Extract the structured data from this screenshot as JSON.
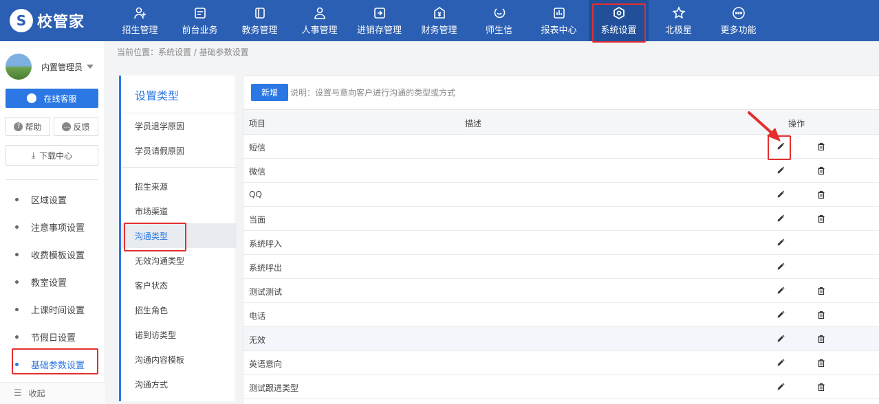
{
  "app": {
    "logo_text": "校管家"
  },
  "nav": [
    {
      "label": "招生管理",
      "icon": "user-plus-icon"
    },
    {
      "label": "前台业务",
      "icon": "card-icon"
    },
    {
      "label": "教务管理",
      "icon": "book-icon"
    },
    {
      "label": "人事管理",
      "icon": "person-icon"
    },
    {
      "label": "进销存管理",
      "icon": "inventory-icon"
    },
    {
      "label": "财务管理",
      "icon": "money-icon"
    },
    {
      "label": "师生信",
      "icon": "chat-icon"
    },
    {
      "label": "报表中心",
      "icon": "chart-icon"
    },
    {
      "label": "系统设置",
      "icon": "gear-icon"
    },
    {
      "label": "北极星",
      "icon": "star-icon"
    },
    {
      "label": "更多功能",
      "icon": "more-icon"
    }
  ],
  "user": {
    "name": "内置管理员"
  },
  "sidebar": {
    "service_label": "在线客服",
    "help_label": "帮助",
    "feedback_label": "反馈",
    "download_label": "下载中心",
    "help_glyph": "?",
    "feedback_glyph": "…",
    "download_glyph": "⤓",
    "collapse_glyph": "☰",
    "menu": [
      {
        "label": "区域设置"
      },
      {
        "label": "注意事项设置"
      },
      {
        "label": "收费模板设置"
      },
      {
        "label": "教室设置"
      },
      {
        "label": "上课时间设置"
      },
      {
        "label": "节假日设置"
      },
      {
        "label": "基础参数设置"
      }
    ],
    "collapse_label": "收起"
  },
  "breadcrumb": {
    "text": "当前位置：系统设置 / 基础参数设置"
  },
  "type_panel": {
    "title": "设置类型",
    "items": [
      "学员退学原因",
      "学员请假原因",
      "招生来源",
      "市场渠道",
      "沟通类型",
      "无效沟通类型",
      "客户状态",
      "招生角色",
      "诺到访类型",
      "沟通内容模板",
      "沟通方式"
    ]
  },
  "table": {
    "add_label": "新增",
    "description": "说明：设置与意向客户进行沟通的类型或方式",
    "columns": {
      "item": "项目",
      "desc": "描述",
      "action": "操作"
    },
    "rows": [
      {
        "name": "短信",
        "deletable": true
      },
      {
        "name": "微信",
        "deletable": true
      },
      {
        "name": "QQ",
        "deletable": true
      },
      {
        "name": "当面",
        "deletable": true
      },
      {
        "name": "系统呼入",
        "deletable": false
      },
      {
        "name": "系统呼出",
        "deletable": false
      },
      {
        "name": "测试测试",
        "deletable": true
      },
      {
        "name": "电话",
        "deletable": true
      },
      {
        "name": "无效",
        "deletable": true
      },
      {
        "name": "英语意向",
        "deletable": true
      },
      {
        "name": "测试跟进类型",
        "deletable": true
      }
    ]
  },
  "colors": {
    "topbar": "#2b5fb3",
    "accent": "#2b78e4",
    "highlight": "#e52e2e"
  }
}
